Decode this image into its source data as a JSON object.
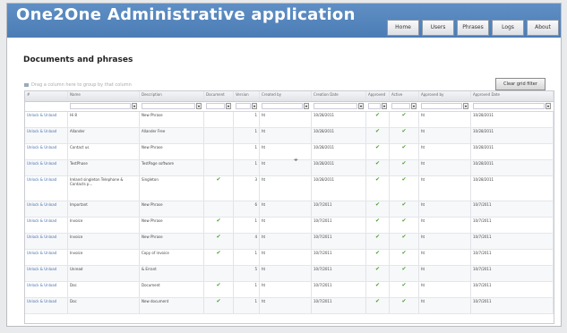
{
  "app": {
    "title": "One2One Administrative application"
  },
  "nav": [
    {
      "label": "Home"
    },
    {
      "label": "Users"
    },
    {
      "label": "Phrases"
    },
    {
      "label": "Logs"
    },
    {
      "label": "About"
    }
  ],
  "page": {
    "title": "Documents and phrases"
  },
  "toolbar": {
    "drag_hint": "Drag a column here to group by that column",
    "clear_filter": "Clear grid filter"
  },
  "grid": {
    "columns": [
      "#",
      "Name",
      "Description",
      "Document",
      "Version",
      "Created by",
      "Creation Date",
      "Approved",
      "Active",
      "Approved by",
      "Approved Date"
    ],
    "rows": [
      {
        "id": "Unlock & Unload",
        "name": "Hi 8",
        "desc": "New Phrase",
        "document": "",
        "version": "1",
        "created_by": "ht",
        "created": "10/28/2011",
        "approved": "✔",
        "active": "✔",
        "approved_by": "ht",
        "approved_date": "10/28/2011"
      },
      {
        "id": "Unlock & Unload",
        "name": "Allander",
        "desc": "Allander Free",
        "document": "",
        "version": "1",
        "created_by": "ht",
        "created": "10/28/2011",
        "approved": "✔",
        "active": "✔",
        "approved_by": "ht",
        "approved_date": "10/28/2011"
      },
      {
        "id": "Unlock & Unload",
        "name": "Contact us",
        "desc": "New Phrase",
        "document": "",
        "version": "1",
        "created_by": "ht",
        "created": "10/28/2011",
        "approved": "✔",
        "active": "✔",
        "approved_by": "ht",
        "approved_date": "10/28/2011"
      },
      {
        "id": "Unlock & Unload",
        "name": "TestPhase",
        "desc": "TestPage software",
        "document": "",
        "version": "1",
        "created_by": "ht",
        "created": "10/28/2011",
        "approved": "✔",
        "active": "✔",
        "approved_by": "ht",
        "approved_date": "10/28/2011"
      },
      {
        "id": "Unlock & Unload",
        "name": "Ireland singleton Telephone & Contacts p...",
        "desc": "Singleton",
        "document": "✔",
        "version": "3",
        "created_by": "ht",
        "created": "10/28/2011",
        "approved": "✔",
        "active": "✔",
        "approved_by": "ht",
        "approved_date": "10/28/2011"
      },
      {
        "id": "Unlock & Unload",
        "name": "Important",
        "desc": "New Phrase",
        "document": "",
        "version": "6",
        "created_by": "ht",
        "created": "10/7/2011",
        "approved": "✔",
        "active": "✔",
        "approved_by": "ht",
        "approved_date": "10/7/2011"
      },
      {
        "id": "Unlock & Unload",
        "name": "Invoice",
        "desc": "New Phrase",
        "document": "✔",
        "version": "1",
        "created_by": "ht",
        "created": "10/7/2011",
        "approved": "✔",
        "active": "✔",
        "approved_by": "ht",
        "approved_date": "10/7/2011"
      },
      {
        "id": "Unlock & Unload",
        "name": "Invoice",
        "desc": "New Phrase",
        "document": "✔",
        "version": "4",
        "created_by": "ht",
        "created": "10/7/2011",
        "approved": "✔",
        "active": "✔",
        "approved_by": "ht",
        "approved_date": "10/7/2011"
      },
      {
        "id": "Unlock & Unload",
        "name": "Invoice",
        "desc": "Copy of invoice",
        "document": "✔",
        "version": "1",
        "created_by": "ht",
        "created": "10/7/2011",
        "approved": "✔",
        "active": "✔",
        "approved_by": "ht",
        "approved_date": "10/7/2011"
      },
      {
        "id": "Unlock & Unload",
        "name": "Unread",
        "desc": "& Errant",
        "document": "",
        "version": "5",
        "created_by": "ht",
        "created": "10/7/2011",
        "approved": "✔",
        "active": "✔",
        "approved_by": "ht",
        "approved_date": "10/7/2011"
      },
      {
        "id": "Unlock & Unload",
        "name": "Doc",
        "desc": "Document",
        "document": "✔",
        "version": "1",
        "created_by": "ht",
        "created": "10/7/2011",
        "approved": "✔",
        "active": "✔",
        "approved_by": "ht",
        "approved_date": "10/7/2011"
      },
      {
        "id": "Unlock & Unload",
        "name": "Doc",
        "desc": "New document",
        "document": "✔",
        "version": "1",
        "created_by": "ht",
        "created": "10/7/2011",
        "approved": "✔",
        "active": "✔",
        "approved_by": "ht",
        "approved_date": "10/7/2011"
      }
    ]
  }
}
